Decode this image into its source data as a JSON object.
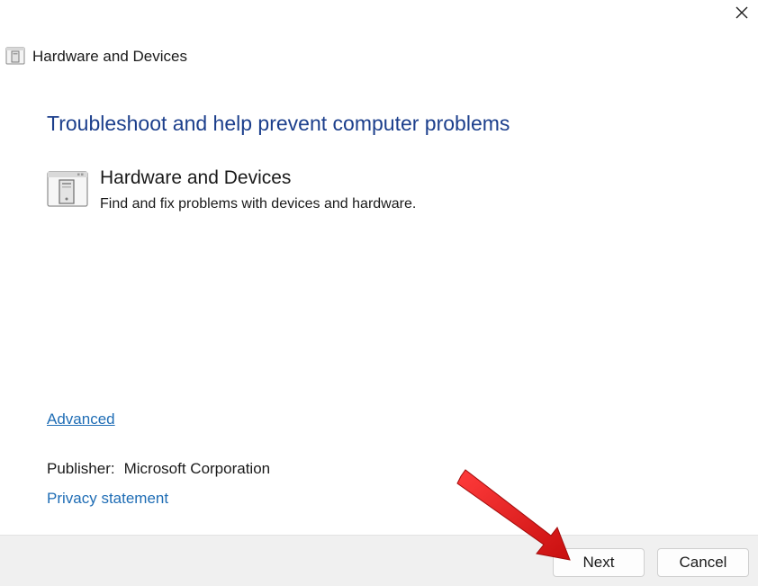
{
  "window": {
    "title": "Hardware and Devices",
    "title_icon": "hardware-device-icon",
    "close_icon": "close-icon"
  },
  "content": {
    "heading": "Troubleshoot and help prevent computer problems",
    "item": {
      "icon": "hardware-device-icon",
      "title": "Hardware and Devices",
      "description": "Find and fix problems with devices and hardware."
    },
    "advanced_link": "Advanced",
    "publisher_label": "Publisher:",
    "publisher_value": "Microsoft Corporation",
    "privacy_link": "Privacy statement"
  },
  "footer": {
    "next_label": "Next",
    "cancel_label": "Cancel"
  },
  "annotation": {
    "arrow_icon": "red-arrow-icon",
    "arrow_color": "#e31b1b"
  },
  "colors": {
    "heading": "#1c3f8c",
    "link": "#1f6db5",
    "footer_bg": "#f0f0f0"
  }
}
